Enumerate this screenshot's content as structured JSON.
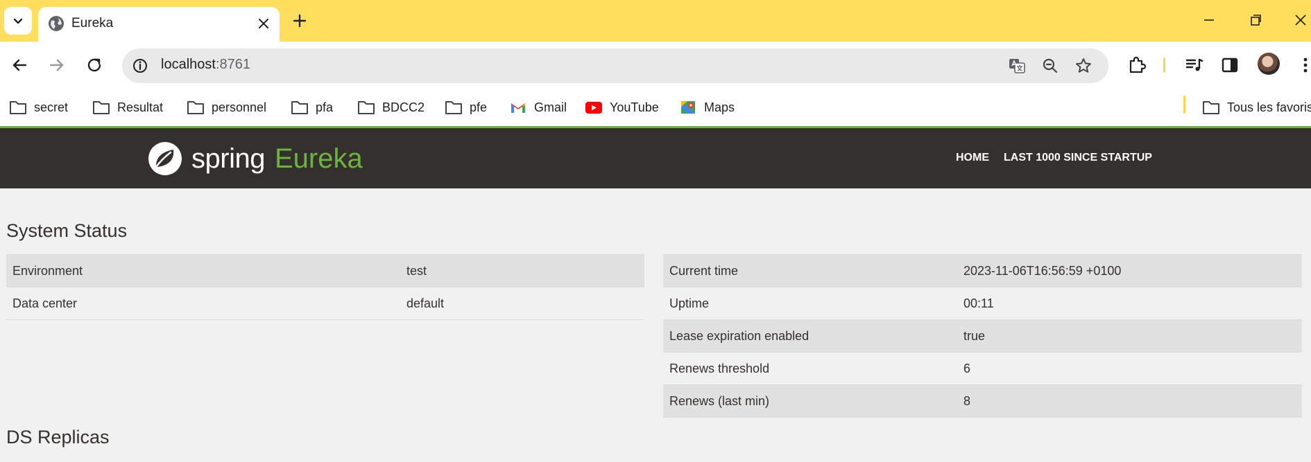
{
  "browser": {
    "tab_title": "Eureka",
    "url_host": "localhost",
    "url_port": ":8761",
    "accent_color": "#ffdf5d"
  },
  "bookmarks": [
    {
      "label": "secret",
      "icon": "folder-icon"
    },
    {
      "label": "Resultat",
      "icon": "folder-icon"
    },
    {
      "label": "personnel",
      "icon": "folder-icon"
    },
    {
      "label": "pfa",
      "icon": "folder-icon"
    },
    {
      "label": "BDCC2",
      "icon": "folder-icon"
    },
    {
      "label": "pfe",
      "icon": "folder-icon"
    },
    {
      "label": "Gmail",
      "icon": "gmail-icon"
    },
    {
      "label": "YouTube",
      "icon": "youtube-icon"
    },
    {
      "label": "Maps",
      "icon": "maps-icon"
    },
    {
      "label": "Tous les favoris",
      "icon": "folder-icon"
    }
  ],
  "eureka": {
    "logo_spring": "spring",
    "logo_eureka": "Eureka",
    "nav": {
      "home": "HOME",
      "last1000": "LAST 1000 SINCE STARTUP"
    },
    "brand_green": "#6db33f",
    "navbar_color": "#34302d"
  },
  "system_status": {
    "title": "System Status",
    "left": [
      {
        "label": "Environment",
        "value": "test"
      },
      {
        "label": "Data center",
        "value": "default"
      }
    ],
    "right": [
      {
        "label": "Current time",
        "value": "2023-11-06T16:56:59 +0100"
      },
      {
        "label": "Uptime",
        "value": "00:11"
      },
      {
        "label": "Lease expiration enabled",
        "value": "true"
      },
      {
        "label": "Renews threshold",
        "value": "6"
      },
      {
        "label": "Renews (last min)",
        "value": "8"
      }
    ]
  },
  "ds_replicas": {
    "title": "DS Replicas"
  }
}
